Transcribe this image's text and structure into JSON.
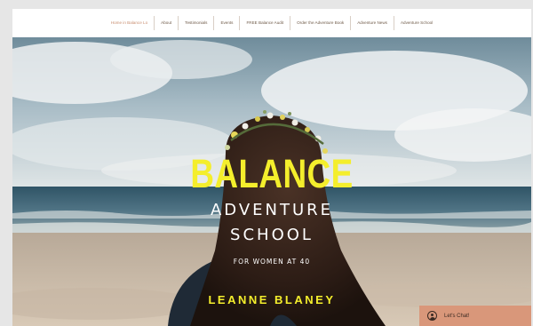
{
  "nav": {
    "items": [
      {
        "label": "Home in Balance Lo",
        "active": true
      },
      {
        "label": "About",
        "active": false
      },
      {
        "label": "Testimonials",
        "active": false
      },
      {
        "label": "Events",
        "active": false
      },
      {
        "label": "FREE Balance Audit",
        "active": false
      },
      {
        "label": "Order the Adventure Book",
        "active": false
      },
      {
        "label": "Adventure News",
        "active": false
      },
      {
        "label": "Adventure School",
        "active": false
      }
    ]
  },
  "hero": {
    "title_line1": "BALANCE",
    "title_line2": "ADVENTURE",
    "title_line3": "SCHOOL",
    "subtitle": "FOR WOMEN AT 40",
    "author": "LEANNE BLANEY"
  },
  "chat": {
    "label": "Let's Chat!",
    "icon": "person-icon"
  },
  "colors": {
    "accent_yellow": "#f4ee2c",
    "chat_bg": "#d9977a",
    "nav_text": "#6f5a48",
    "nav_active": "#c98d6f"
  }
}
